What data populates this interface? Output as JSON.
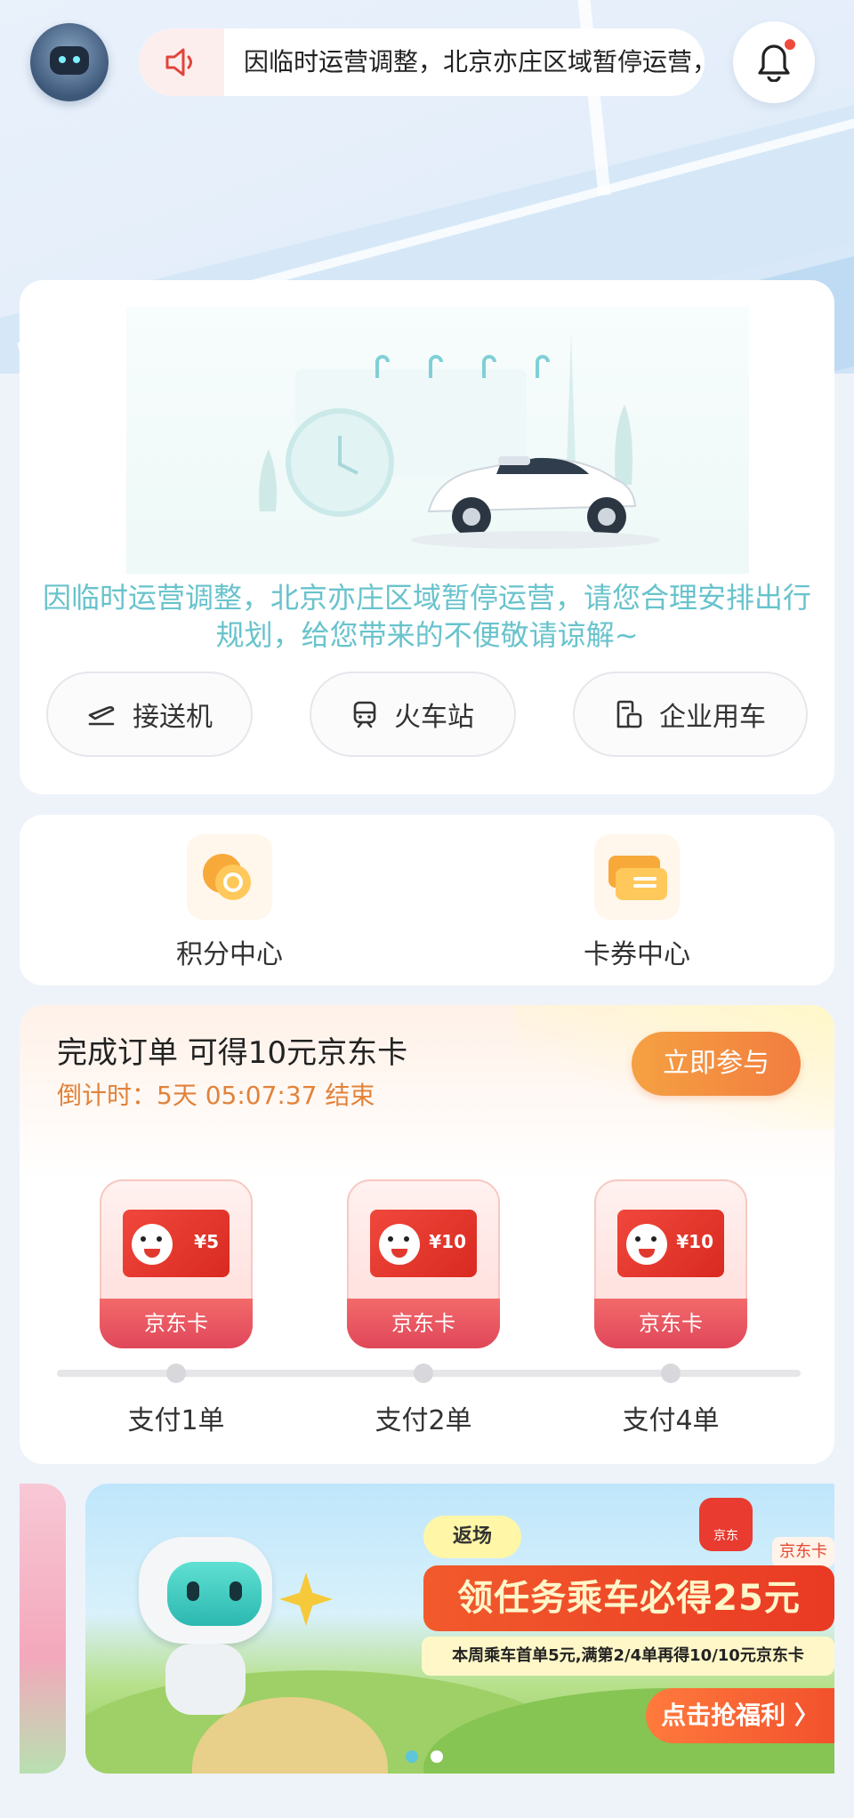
{
  "header": {
    "notice_text": "因临时运营调整，北京亦庄区域暂停运营，请您合理安排出行规划，给您带来的不便敬请谅解~"
  },
  "main_card": {
    "message": "因临时运营调整，北京亦庄区域暂停运营，请您合理安排出行规划，给您带来的不便敬请谅解~",
    "chips": [
      {
        "label": "接送机",
        "icon": "airplane-icon"
      },
      {
        "label": "火车站",
        "icon": "train-icon"
      },
      {
        "label": "企业用车",
        "icon": "enterprise-icon"
      }
    ]
  },
  "quick_entries": [
    {
      "label": "积分中心",
      "icon": "points-coin-icon"
    },
    {
      "label": "卡券中心",
      "icon": "coupon-icon"
    }
  ],
  "task_card": {
    "title": "完成订单 可得10元京东卡",
    "countdown": "倒计时：5天 05:07:37 结束",
    "join_label": "立即参与",
    "rewards": [
      {
        "amount": "¥5",
        "ribbon": "京东卡",
        "step": "支付1单"
      },
      {
        "amount": "¥10",
        "ribbon": "京东卡",
        "step": "支付2单"
      },
      {
        "amount": "¥10",
        "ribbon": "京东卡",
        "step": "支付4单"
      }
    ]
  },
  "banner": {
    "return_tag": "返场",
    "jd_logo": "京东",
    "jd_tag": "京东卡",
    "headline": "领任务乘车必得25元",
    "subline": "本周乘车首单5元,满第2/4单再得10/10元京东卡",
    "cta": "点击抢福利 〉"
  },
  "carousel": {
    "total": 2,
    "active_index": 0
  },
  "colors": {
    "accent_teal": "#68c3cc",
    "orange": "#f27d3f",
    "countdown": "#e2823a",
    "jd_red": "#e93b30"
  }
}
